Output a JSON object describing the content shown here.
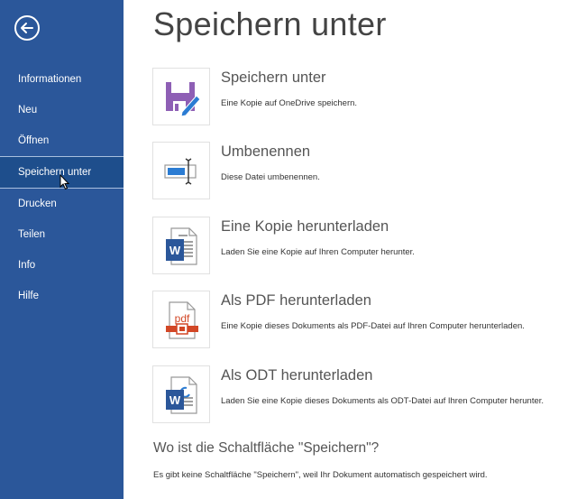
{
  "sidebar": {
    "back_icon": "back-arrow-circle-icon",
    "items": [
      {
        "label": "Informationen",
        "active": false
      },
      {
        "label": "Neu",
        "active": false
      },
      {
        "label": "Öffnen",
        "active": false
      },
      {
        "label": "Speichern unter",
        "active": true
      },
      {
        "label": "Drucken",
        "active": false
      },
      {
        "label": "Teilen",
        "active": false
      },
      {
        "label": "Info",
        "active": false
      },
      {
        "label": "Hilfe",
        "active": false
      }
    ]
  },
  "main": {
    "title": "Speichern unter",
    "options": [
      {
        "icon": "save-as-floppy-pencil-icon",
        "title": "Speichern unter",
        "description": "Eine Kopie auf OneDrive speichern."
      },
      {
        "icon": "rename-icon",
        "title": "Umbenennen",
        "description": "Diese Datei umbenennen."
      },
      {
        "icon": "word-document-icon",
        "title": "Eine Kopie herunterladen",
        "description": "Laden Sie eine Kopie auf Ihren Computer herunter."
      },
      {
        "icon": "pdf-document-icon",
        "title": "Als PDF herunterladen",
        "description": "Eine Kopie dieses Dokuments als PDF-Datei auf Ihren Computer herunterladen."
      },
      {
        "icon": "odt-document-icon",
        "title": "Als ODT herunterladen",
        "description": "Laden Sie eine Kopie dieses Dokuments als ODT-Datei auf Ihren Computer herunter."
      }
    ],
    "help": {
      "title": "Wo ist die Schaltfläche \"Speichern\"?",
      "description": "Es gibt keine Schaltfläche \"Speichern\", weil Ihr Dokument automatisch gespeichert wird."
    }
  },
  "colors": {
    "sidebar_bg": "#2b579a",
    "sidebar_active": "#1e4e8c",
    "save_icon": "#8e5fb5",
    "word_blue": "#2b579a",
    "pdf_red": "#d24726"
  }
}
